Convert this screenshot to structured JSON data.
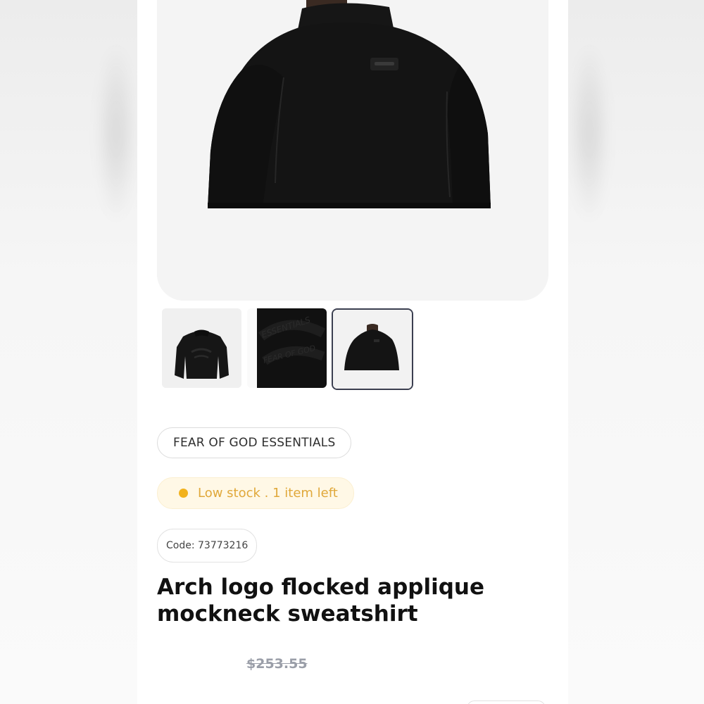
{
  "product": {
    "hero_image": {
      "description_icon": "sweatshirt-back-photo"
    },
    "thumbnails": [
      {
        "icon": "sweatshirt-front-photo",
        "selected": false
      },
      {
        "icon": "arch-logo-closeup-photo",
        "selected": false,
        "logo_text_line1": "ESSENTIALS",
        "logo_text_line2": "FEAR OF GOD"
      },
      {
        "icon": "sweatshirt-back-photo",
        "selected": true
      }
    ],
    "brand": "FEAR OF GOD ESSENTIALS",
    "stock": {
      "label": "Low stock . 1 item left",
      "color": "#e0a83a",
      "dot_color": "#f2b21c"
    },
    "code_label": "Code: 73773216",
    "title": "Arch logo flocked applique mockneck sweatshirt",
    "old_price": "$253.55"
  },
  "colors": {
    "text_primary": "#111111",
    "muted_price": "#9a9ea8",
    "selected_border": "#3b3f50",
    "hero_bg": "#f4f4f4"
  }
}
